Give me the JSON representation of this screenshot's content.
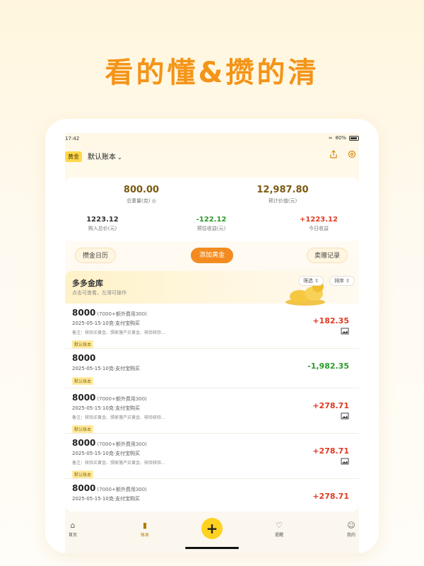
{
  "headline": "看的懂&攒的清",
  "status": {
    "time": "17:42",
    "battery": "80%"
  },
  "header": {
    "tag": "黄金",
    "account_name": "默认账本"
  },
  "summary": {
    "total_weight": {
      "value": "800.00",
      "label": "总重量(克)"
    },
    "estimated_value": {
      "value": "12,987.80",
      "label": "预计价值(元)"
    },
    "purchase_total": {
      "value": "1223.12",
      "label": "购入总价(元)"
    },
    "estimated_profit": {
      "value": "-122.12",
      "label": "预估收益(元)"
    },
    "today_profit": {
      "value": "+1223.12",
      "label": "今日收益"
    }
  },
  "actions": {
    "calendar": "攒金日历",
    "add_gold": "添加黄金",
    "sell_records": "卖赠记录"
  },
  "vault": {
    "title": "多多金库",
    "subtitle": "点击可查看，左滑可操作",
    "filter_label": "筛选",
    "sort_label": "排序",
    "records": [
      {
        "amount": "8000",
        "detail": "(7000+额外费用300)",
        "meta": "2025-05-15·10克·支付宝购买",
        "note": "备注：核验买黄金、颁家落产买黄金、核验核验...",
        "account": "默认账本",
        "profit": "+182.35",
        "profit_sign": "pos"
      },
      {
        "amount": "8000",
        "detail": "",
        "meta": "2025-05-15·10克·支付宝购买",
        "note": "",
        "account": "默认账本",
        "profit": "-1,982.35",
        "profit_sign": "neg"
      },
      {
        "amount": "8000",
        "detail": "(7000+额外费用300)",
        "meta": "2025-05-15·10克·支付宝购买",
        "note": "备注：核验买黄金、颁家落产买黄金、核验核验...",
        "account": "默认账本",
        "profit": "+278.71",
        "profit_sign": "pos"
      },
      {
        "amount": "8000",
        "detail": "(7000+额外费用300)",
        "meta": "2025-05-15·10克·支付宝购买",
        "note": "备注：核验买黄金、颁家落产买黄金、核验核验...",
        "account": "默认账本",
        "profit": "+278.71",
        "profit_sign": "pos"
      },
      {
        "amount": "8000",
        "detail": "(7000+额外费用300)",
        "meta": "2025-05-15·10克·支付宝购买",
        "note": "",
        "account": "",
        "profit": "+278.71",
        "profit_sign": "pos"
      }
    ]
  },
  "tabs": {
    "home": "首页",
    "ledger": "账本",
    "reminder": "提醒",
    "mine": "我的"
  },
  "colors": {
    "accent": "#f48b20",
    "gold_tag": "#ffd84a",
    "positive": "#e03a22",
    "negative": "#2a9a2a"
  }
}
